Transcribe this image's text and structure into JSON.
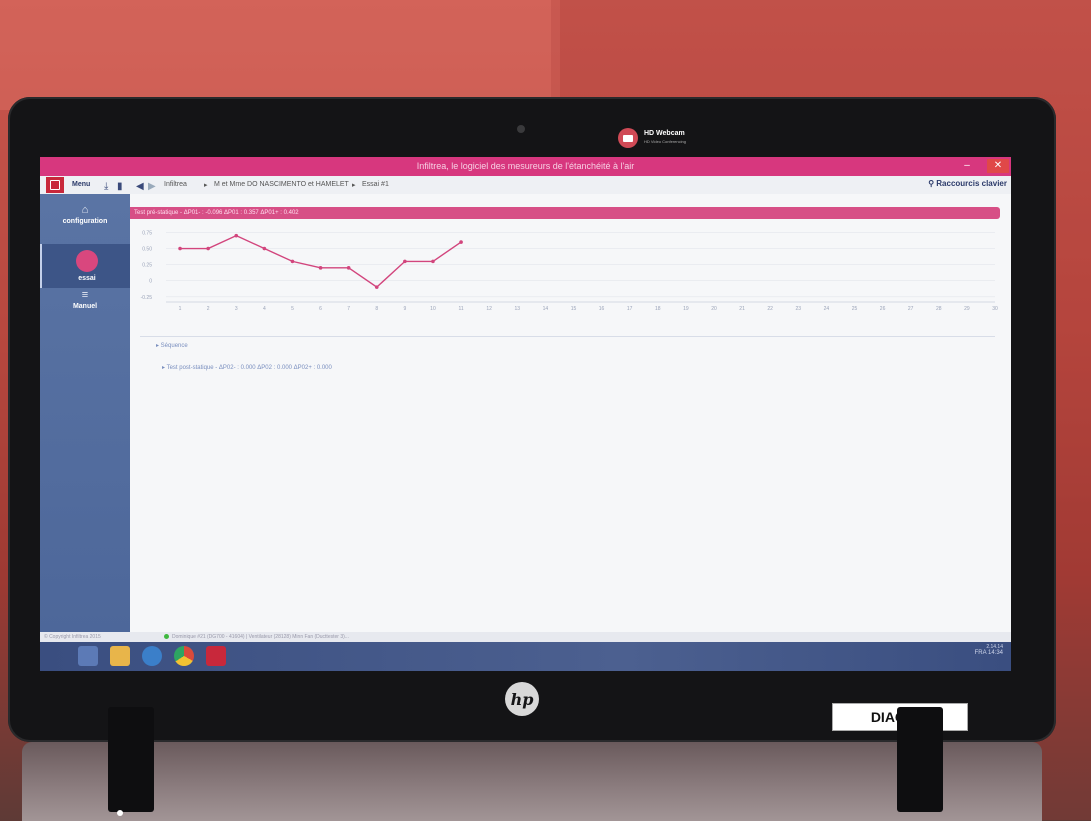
{
  "window": {
    "title": "Infiltrea, le logiciel des mesureurs de l'étanchéité à l'air",
    "minimize": "–",
    "close": "✕"
  },
  "webcam": {
    "label": "HD Webcam",
    "sublabel": "HD Video Conferencing"
  },
  "menubar": {
    "menu_label": "Menu",
    "breadcrumb": [
      "Infiltrea",
      "M et Mme DO NASCIMENTO et HAMELET",
      "Essai #1"
    ],
    "shortcut_label": "Raccourcis clavier"
  },
  "sidebar": {
    "items": [
      {
        "label": "configuration",
        "icon": "home-icon"
      },
      {
        "label": "essai",
        "icon": "gauge-icon"
      },
      {
        "label": "Manuel",
        "icon": "list-icon"
      }
    ]
  },
  "test_pre": {
    "header": "Test pré-statique - ΔP01- : -0.096  ΔP01 : 0.357  ΔP01+ : 0.402"
  },
  "sections": {
    "sequence": "▸ Séquence",
    "test_post": "▸ Test post-statique - ΔP02- : 0.000  ΔP02 : 0.000  ΔP02+ : 0.000"
  },
  "status": {
    "copyright": "© Copyright Infiltrea 2015",
    "device": "Dominique #21 (DG700 - 41604)  |  Ventilateur (28128) Minn Fan (Ducttester 3)..."
  },
  "taskbar": {
    "tray": "FRA",
    "time": "14:34",
    "version": "2.14.14"
  },
  "laptop": {
    "asset_tag": "DIAG051",
    "brand": "hp"
  },
  "colors": {
    "accent": "#d7377e",
    "sidebar": "#4d679a",
    "line": "#d2457d"
  },
  "chart_data": {
    "type": "line",
    "title": "",
    "x": [
      1,
      2,
      3,
      4,
      5,
      6,
      7,
      8,
      9,
      10,
      11
    ],
    "series": [
      {
        "values": [
          0.5,
          0.5,
          0.7,
          0.5,
          0.3,
          0.2,
          0.2,
          -0.1,
          0.3,
          0.3,
          0.6
        ]
      }
    ],
    "xticks": [
      1,
      2,
      3,
      4,
      5,
      6,
      7,
      8,
      9,
      10,
      11,
      12,
      13,
      14,
      15,
      16,
      17,
      18,
      19,
      20,
      21,
      22,
      23,
      24,
      25,
      26,
      27,
      28,
      29,
      30
    ],
    "yticks": [
      "0.75",
      "0.50",
      "0.25",
      "0",
      "-0.25"
    ],
    "xlim": [
      0.5,
      30
    ],
    "ylim": [
      -0.3,
      0.85
    ],
    "grid": true
  }
}
